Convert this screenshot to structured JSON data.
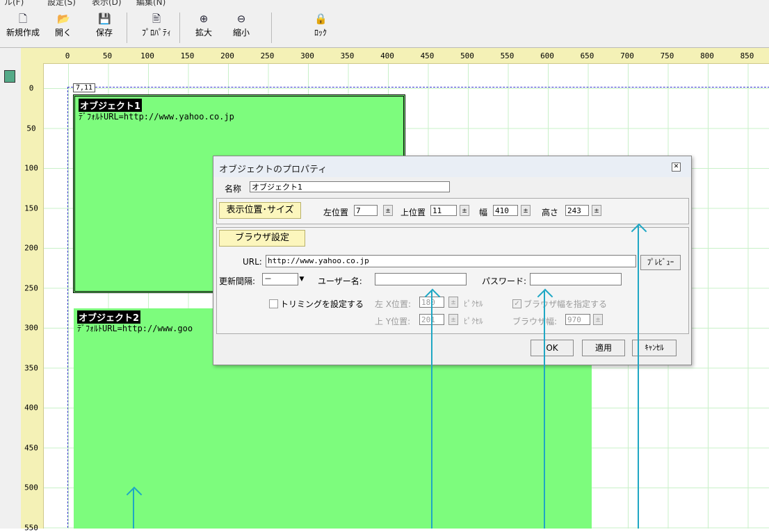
{
  "menubar": {
    "items": [
      "ル(F)",
      "設定(S)",
      "表示(D)",
      "編集(N)"
    ]
  },
  "toolbar": {
    "new": "新規作成",
    "open": "開く",
    "save": "保存",
    "properties": "ﾌﾟﾛﾊﾟﾃｨ",
    "zoom_in": "拡大",
    "zoom_out": "縮小",
    "lock": "ﾛｯｸ"
  },
  "ruler": {
    "h_ticks": [
      "0",
      "50",
      "100",
      "150",
      "200",
      "250",
      "300",
      "350",
      "400",
      "450",
      "500",
      "550",
      "600",
      "650",
      "700",
      "750",
      "800",
      "850"
    ],
    "v_ticks": [
      "0",
      "50",
      "100",
      "150",
      "200",
      "250",
      "300",
      "350",
      "400",
      "450",
      "500",
      "550"
    ]
  },
  "canvas": {
    "coord_label": "7,11",
    "objects": [
      {
        "name": "オブジェクト1",
        "url": "ﾃﾞﾌｫﾙﾄURL=http://www.yahoo.co.jp"
      },
      {
        "name": "オブジェクト2",
        "url": "ﾃﾞﾌｫﾙﾄURL=http://www.goo"
      }
    ]
  },
  "dialog": {
    "title": "オブジェクトのプロパティ",
    "name_label": "名称",
    "name_value": "オブジェクト1",
    "position_section": "表示位置･サイズ",
    "left_label": "左位置",
    "left_value": "7",
    "top_label": "上位置",
    "top_value": "11",
    "width_label": "幅",
    "width_value": "410",
    "height_label": "高さ",
    "height_value": "243",
    "browser_section": "ブラウザ設定",
    "url_label": "URL:",
    "url_value": "http://www.yahoo.co.jp",
    "preview_button": "ﾌﾟﾚﾋﾞｭｰ",
    "refresh_label": "更新間隔:",
    "refresh_value": "－",
    "username_label": "ユーザー名:",
    "username_value": "",
    "password_label": "パスワード:",
    "password_value": "",
    "trim_label": "トリミングを設定する",
    "trim_checked": false,
    "x_label": "左 X位置:",
    "x_value": "180",
    "y_label": "上 Y位置:",
    "y_value": "201",
    "pixel_unit": "ﾋﾟｸｾﾙ",
    "browser_width_check_label": "ブラウザ幅を指定する",
    "browser_width_label": "ブラウザ幅:",
    "browser_width_value": "970",
    "ok_button": "OK",
    "apply_button": "適用",
    "cancel_button": "ｷｬﾝｾﾙ"
  },
  "colors": {
    "object_fill": "#7dfc7d",
    "ruler": "#f4f1b6",
    "arrow": "#1fa7c4",
    "section_button": "#fcf6bd"
  }
}
